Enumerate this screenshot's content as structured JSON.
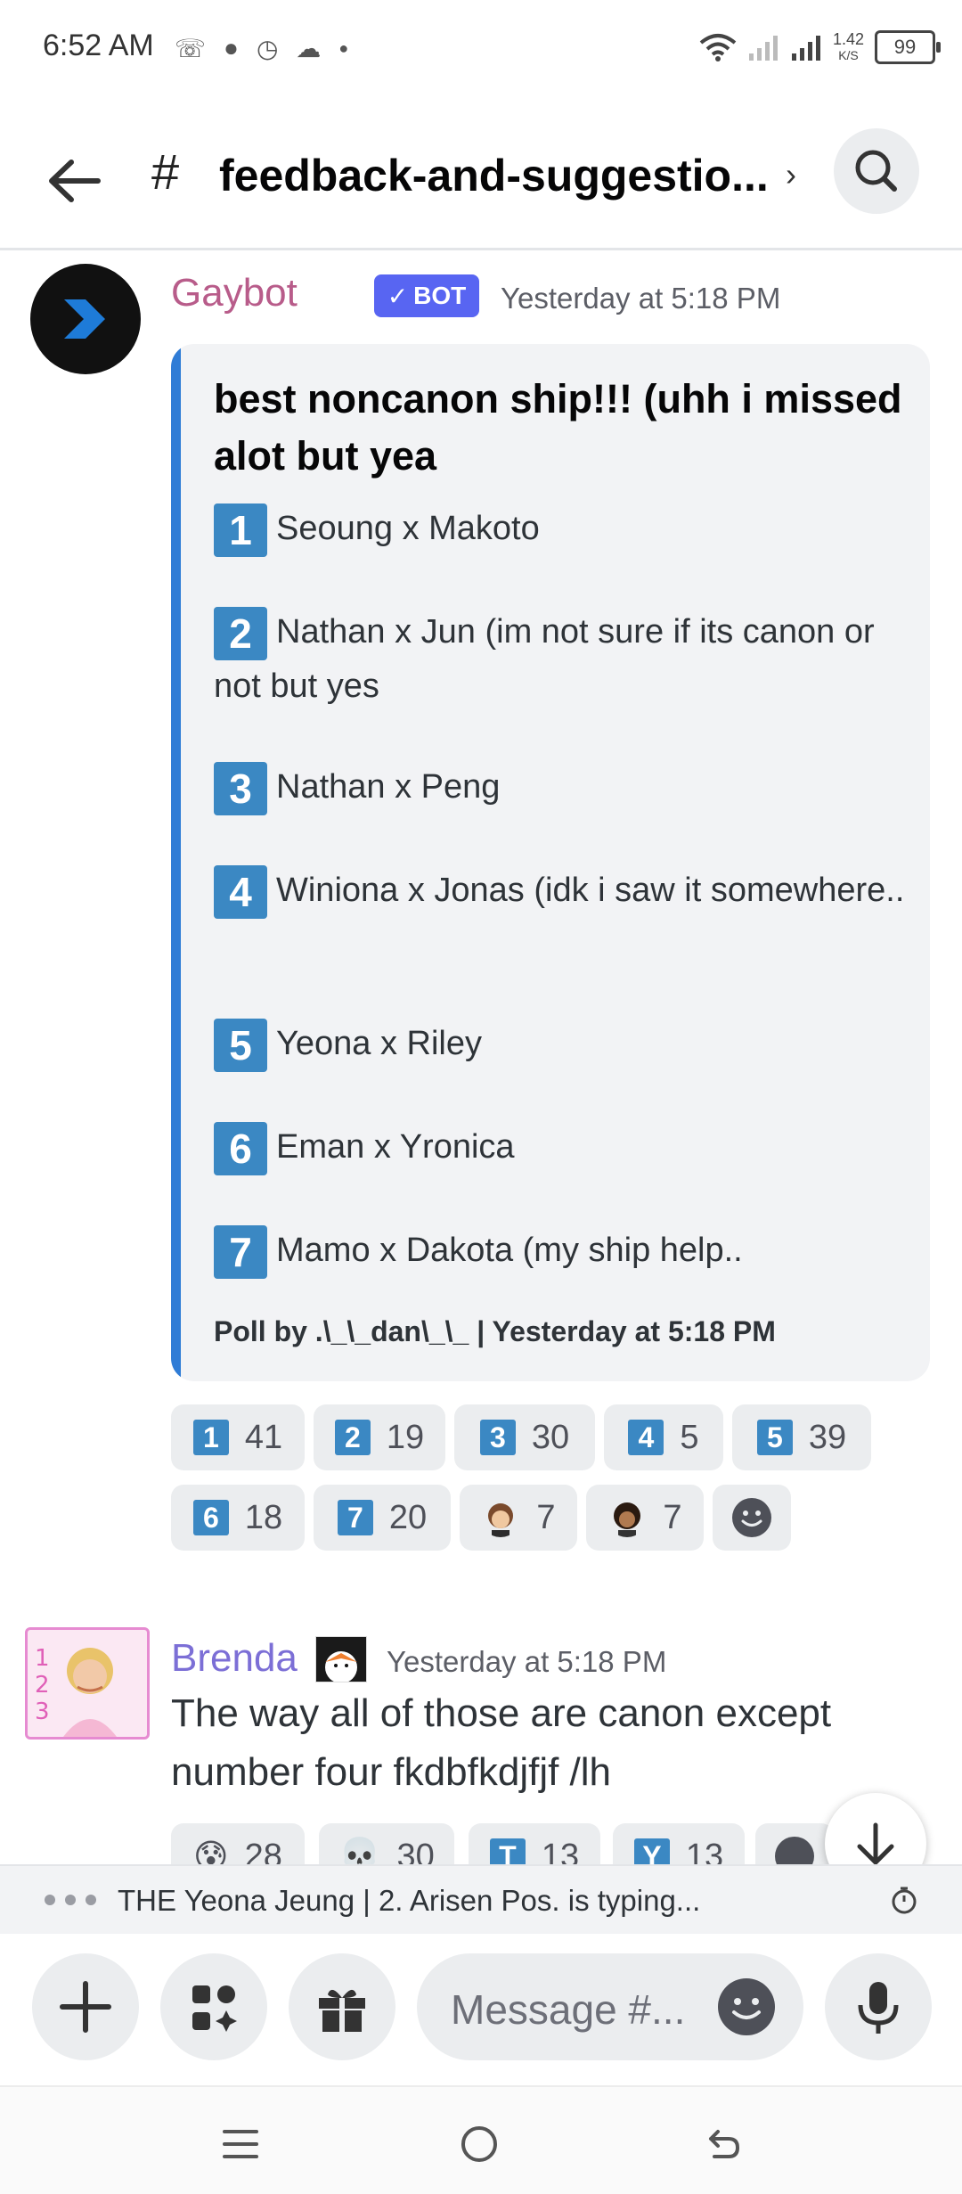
{
  "status_bar": {
    "time": "6:52 AM",
    "net_speed_value": "1.42",
    "net_speed_unit": "K/S",
    "battery": "99"
  },
  "header": {
    "channel_prefix": "#",
    "channel_name": "feedback-and-suggestio...",
    "chevron": "›"
  },
  "bot_message": {
    "author": "Gaybot",
    "author_color": "#b85c8a",
    "bot_tag": "BOT",
    "timestamp": "Yesterday at 5:18 PM",
    "embed": {
      "title": "best noncanon ship!!! (uhh i missed alot but yea",
      "options": [
        {
          "num": "1",
          "text": "Seoung x Makoto"
        },
        {
          "num": "2",
          "text": "Nathan x Jun (im not sure if its canon or not but yes"
        },
        {
          "num": "3",
          "text": "Nathan x Peng"
        },
        {
          "num": "4",
          "text": "Winiona x Jonas (idk i saw it somewhere.."
        },
        {
          "num": "5",
          "text": "Yeona x Riley"
        },
        {
          "num": "6",
          "text": "Eman x Yronica"
        },
        {
          "num": "7",
          "text": "Mamo x Dakota (my ship help.."
        }
      ],
      "footer": "Poll by .\\_\\_dan\\_\\_ | Yesterday at 5:18 PM"
    },
    "reactions": [
      {
        "emoji": "1",
        "count": "41"
      },
      {
        "emoji": "2",
        "count": "19"
      },
      {
        "emoji": "3",
        "count": "30"
      },
      {
        "emoji": "4",
        "count": "5"
      },
      {
        "emoji": "5",
        "count": "39"
      },
      {
        "emoji": "6",
        "count": "18"
      },
      {
        "emoji": "7",
        "count": "20"
      },
      {
        "emoji": "custom-face-1",
        "count": "7"
      },
      {
        "emoji": "custom-face-2",
        "count": "7"
      }
    ]
  },
  "user_message": {
    "author": "Brenda",
    "author_color": "#7c6fd6",
    "timestamp": "Yesterday at 5:18 PM",
    "text": "The way all of those are canon except number four fkdbfkdjfjf /lh",
    "reactions": [
      {
        "emoji": "😰",
        "count": "28"
      },
      {
        "emoji": "💀",
        "count": "30"
      },
      {
        "emoji": "T",
        "count": "13"
      },
      {
        "emoji": "Y",
        "count": "13"
      }
    ]
  },
  "typing_indicator": {
    "text": "THE Yeona Jeung | 2. Arisen Pos. is typing..."
  },
  "composer": {
    "placeholder": "Message #..."
  },
  "colors": {
    "accent": "#5865f2",
    "embed_bar": "#2f7cd6",
    "keycap": "#3b88c3"
  }
}
